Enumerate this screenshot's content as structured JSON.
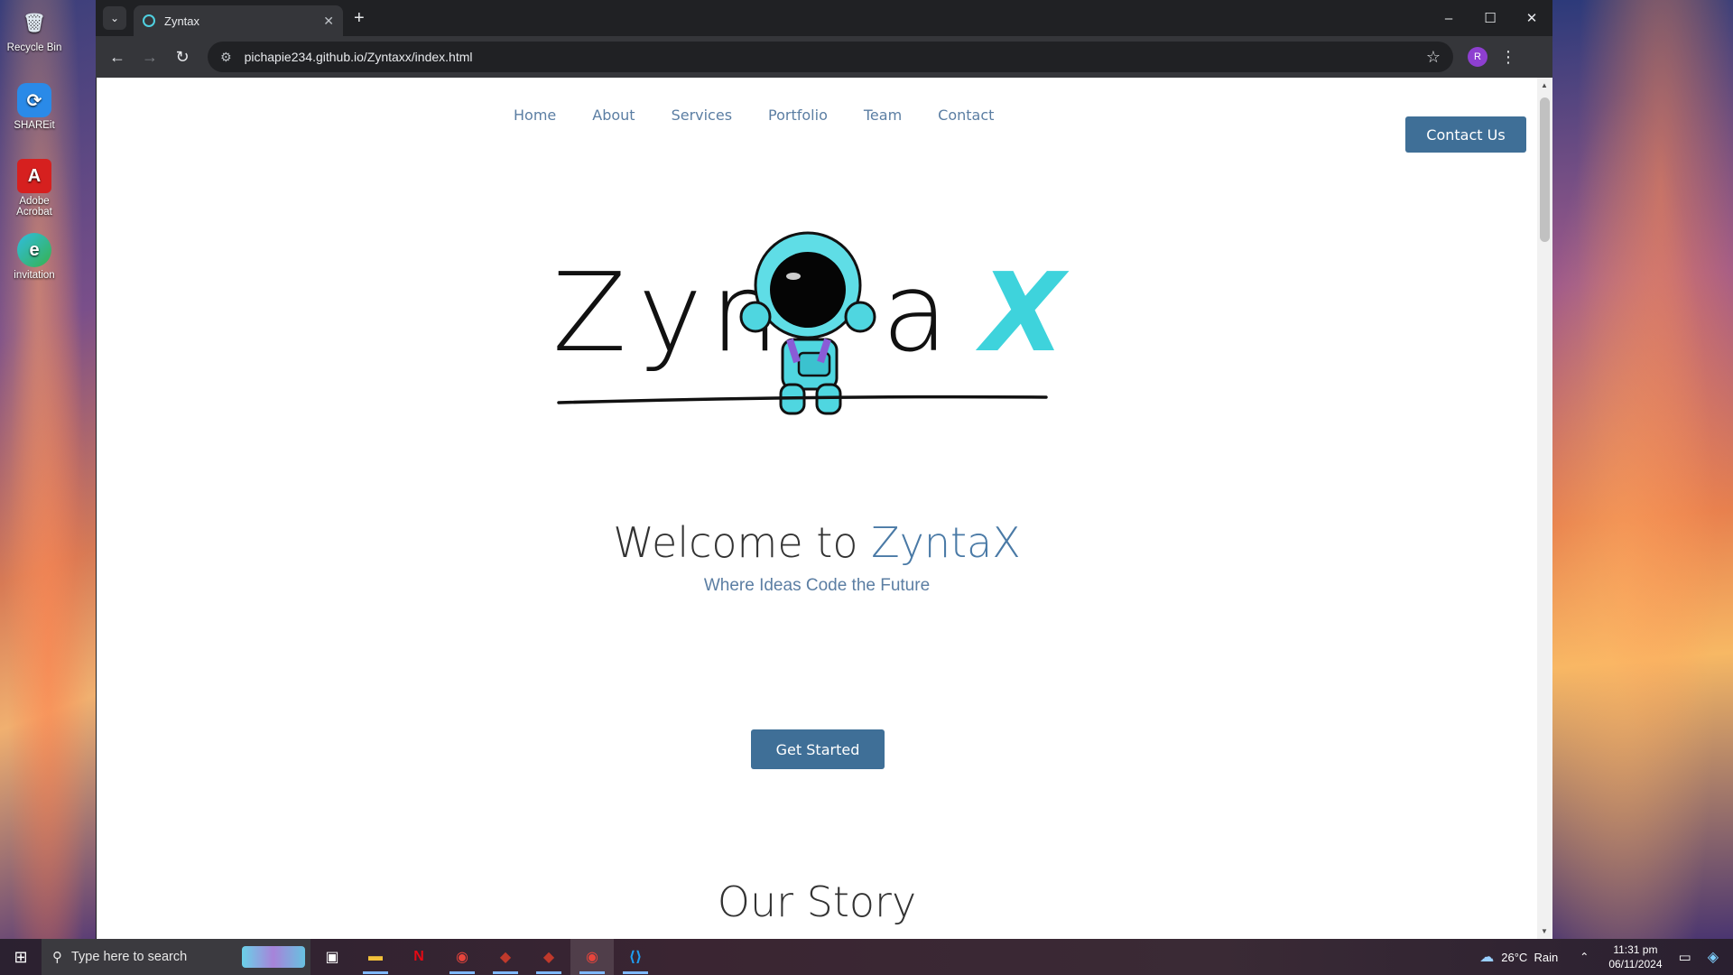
{
  "desktop": {
    "icons": [
      {
        "label": "Recycle Bin",
        "glyph": "🗑"
      },
      {
        "label": "SHAREit",
        "glyph": "⟳"
      },
      {
        "label": "Adobe Acrobat",
        "glyph": "A"
      },
      {
        "label": "invitation",
        "glyph": "e"
      }
    ]
  },
  "browser": {
    "tab_title": "Zyntax",
    "new_tab_label": "+",
    "tab_close": "✕",
    "url": "pichapie234.github.io/Zyntaxx/index.html",
    "profile_initial": "R",
    "window_controls": {
      "minimize": "–",
      "maximize": "☐",
      "close": "✕"
    }
  },
  "site": {
    "nav": [
      "Home",
      "About",
      "Services",
      "Portfolio",
      "Team",
      "Contact"
    ],
    "contact_button": "Contact Us",
    "logo": {
      "word": "Zyn aa",
      "letters": [
        "Z",
        "y",
        "n",
        "a"
      ],
      "x_letter": "X"
    },
    "hero": {
      "title_prefix": "Welcome to ",
      "title_accent": "ZyntaX",
      "subtitle": "Where Ideas Code the Future",
      "cta": "Get Started"
    },
    "story_heading": "Our Story"
  },
  "taskbar": {
    "search_placeholder": "Type here to search",
    "weather": {
      "temp": "26°C",
      "condition": "Rain"
    },
    "time": "11:31 pm",
    "date": "06/11/2024",
    "colors": {
      "netflix": "#e50914",
      "vscode": "#1f9cf0",
      "explorer": "#f3c13a"
    }
  }
}
